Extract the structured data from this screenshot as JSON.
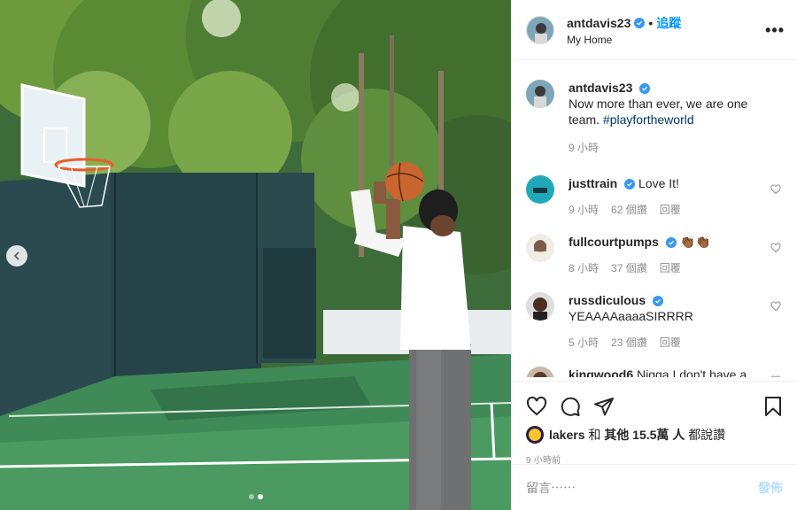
{
  "post": {
    "username": "antdavis23",
    "follow_label": "追蹤",
    "location": "My Home",
    "more_label": "•••",
    "caption_text": "Now more than ever, we are one team.",
    "caption_hashtag": "#playfortheworld",
    "caption_time": "9 小時",
    "accent_color": "#0095f6",
    "verified_color": "#3897f0"
  },
  "comments": [
    {
      "username": "justtrain",
      "text": "Love It!",
      "time": "9 小時",
      "likes": "62 個讚",
      "reply": "回覆"
    },
    {
      "username": "fullcourtpumps",
      "text": "👏🏾👏🏾",
      "time": "8 小時",
      "likes": "37 個讚",
      "reply": "回覆"
    },
    {
      "username": "russdiculous",
      "text": "YEAAAAaaaaSIRRRR",
      "time": "5 小時",
      "likes": "23 個讚",
      "reply": "回覆"
    },
    {
      "username": "kingwood6",
      "text": "Nigga I don't have a"
    }
  ],
  "likes": {
    "username": "lakers",
    "and": "和",
    "others": "其他 15.5萬 人",
    "suffix": "都說讚"
  },
  "posted_time": "9 小時前",
  "comment_box": {
    "placeholder": "留言⋯⋯",
    "post_label": "發佈"
  },
  "carousel": {
    "count": 2,
    "active": 2
  },
  "icons": [
    "heart-icon",
    "comment-icon",
    "share-icon",
    "bookmark-icon",
    "chevron-left-icon",
    "verified-icon",
    "more-icon"
  ]
}
